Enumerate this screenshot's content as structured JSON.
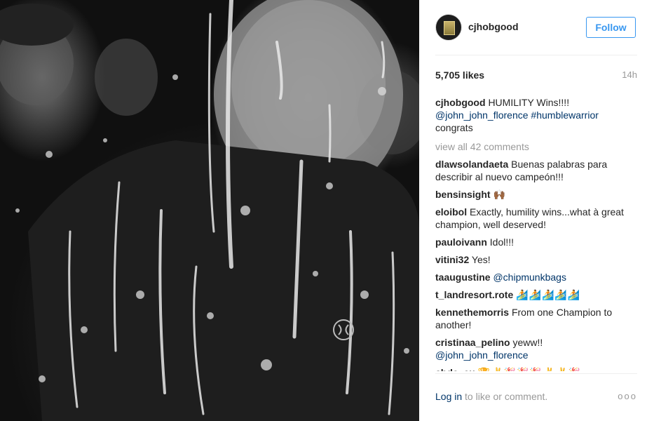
{
  "post": {
    "username": "cjhobgood",
    "follow_label": "Follow",
    "likes": "5,705 likes",
    "time": "14h",
    "caption": {
      "user": "cjhobgood",
      "text": "HUMILITY Wins!!!!",
      "mention": "@john_john_florence",
      "hashtag": "#humblewarrior",
      "tail": "congrats"
    },
    "view_all": "view all 42 comments",
    "comments": [
      {
        "user": "dlawsolandaeta",
        "text": "Buenas palabras para describir al nuevo campeón!!!"
      },
      {
        "user": "bensinsight",
        "text": "🙌🏾"
      },
      {
        "user": "eloibol",
        "text": "Exactly, humility wins...what à great champion, well deserved!"
      },
      {
        "user": "pauloivann",
        "text": "Idol!!!"
      },
      {
        "user": "vitini32",
        "text": "Yes!"
      },
      {
        "user": "taaugustine",
        "text": "@chipmunkbags"
      },
      {
        "user": "t_landresort.rote",
        "text": "🏄🏄🏄🏄🏄"
      },
      {
        "user": "kennethemorris",
        "text": "From one Champion to another!"
      },
      {
        "user": "cristinaa_pelino",
        "text": "yeww!!",
        "mention": "@john_john_florence"
      },
      {
        "user": "chde_eu",
        "text": "🏆✌🎉🎉🎉✌✌🎉"
      }
    ],
    "login_link": "Log in",
    "login_text": "to like or comment.",
    "more": "ooo"
  },
  "colors": {
    "link_blue": "#3897f0",
    "mention_blue": "#003569",
    "muted": "#999999"
  }
}
